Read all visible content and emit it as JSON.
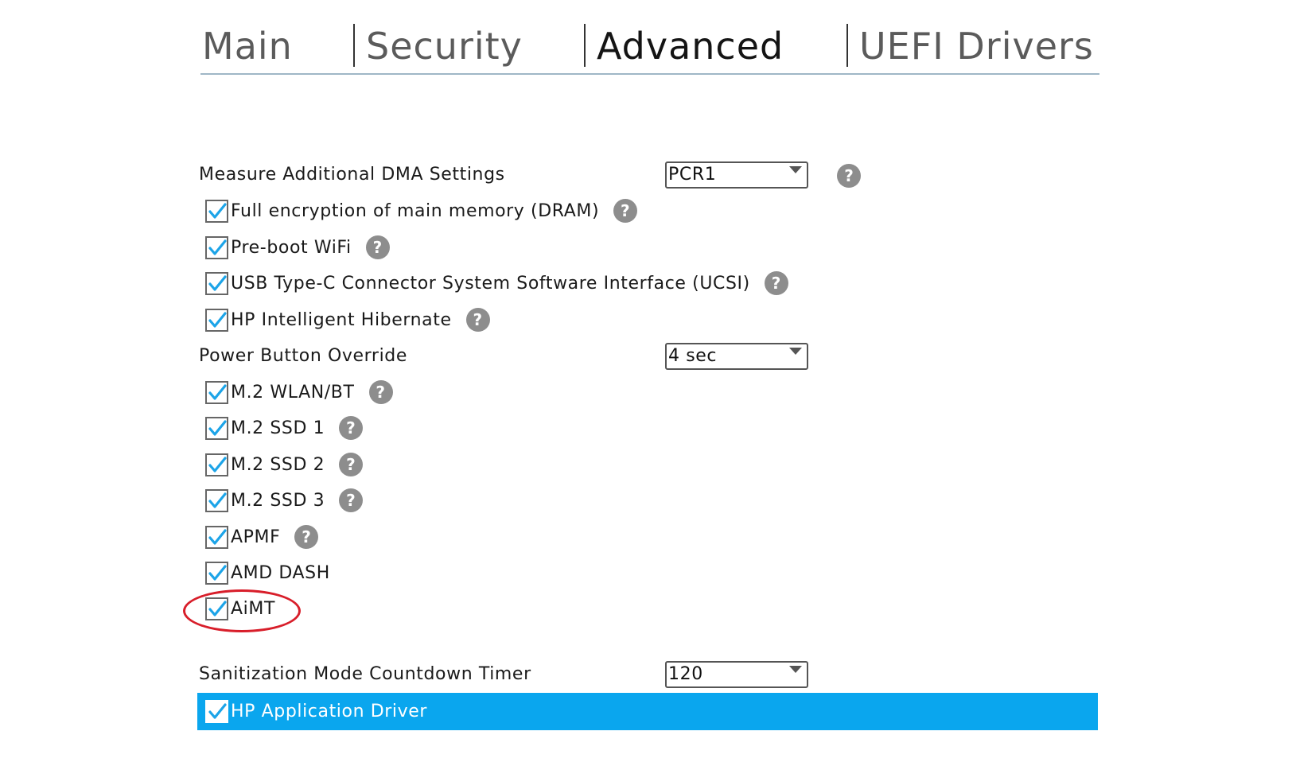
{
  "tabs": [
    {
      "label": "Main"
    },
    {
      "label": "Security"
    },
    {
      "label": "Advanced"
    },
    {
      "label": "UEFI Drivers"
    }
  ],
  "active_tab": "Advanced",
  "settings": {
    "dma": {
      "label": "Measure Additional DMA Settings",
      "value": "PCR1"
    },
    "full_encryption": {
      "label": "Full encryption of main memory (DRAM)",
      "checked": true
    },
    "preboot_wifi": {
      "label": "Pre-boot WiFi",
      "checked": true
    },
    "ucsi": {
      "label": "USB Type-C Connector System Software Interface (UCSI)",
      "checked": true
    },
    "hibernate": {
      "label": "HP Intelligent Hibernate",
      "checked": true
    },
    "power_button": {
      "label": "Power Button Override",
      "value": "4 sec"
    },
    "wlan": {
      "label": "M.2 WLAN/BT",
      "checked": true
    },
    "ssd1": {
      "label": "M.2 SSD 1",
      "checked": true
    },
    "ssd2": {
      "label": "M.2 SSD 2",
      "checked": true
    },
    "ssd3": {
      "label": "M.2 SSD 3",
      "checked": true
    },
    "apmf": {
      "label": "APMF",
      "checked": true
    },
    "amd_dash": {
      "label": "AMD DASH",
      "checked": true
    },
    "aimt": {
      "label": "AiMT",
      "checked": true
    },
    "sanitization": {
      "label": "Sanitization Mode Countdown Timer",
      "value": "120"
    },
    "hp_app_driver": {
      "label": "HP Application Driver",
      "checked": true
    }
  },
  "help_glyph": "?",
  "icons": {
    "help": "help-circle-icon",
    "check": "checkmark-icon",
    "dropdown": "chevron-down-icon"
  },
  "colors": {
    "accent": "#0aa6ee",
    "check": "#1ca4e8",
    "annotation": "#d81e2a",
    "help_icon": "#8d8d8d"
  }
}
